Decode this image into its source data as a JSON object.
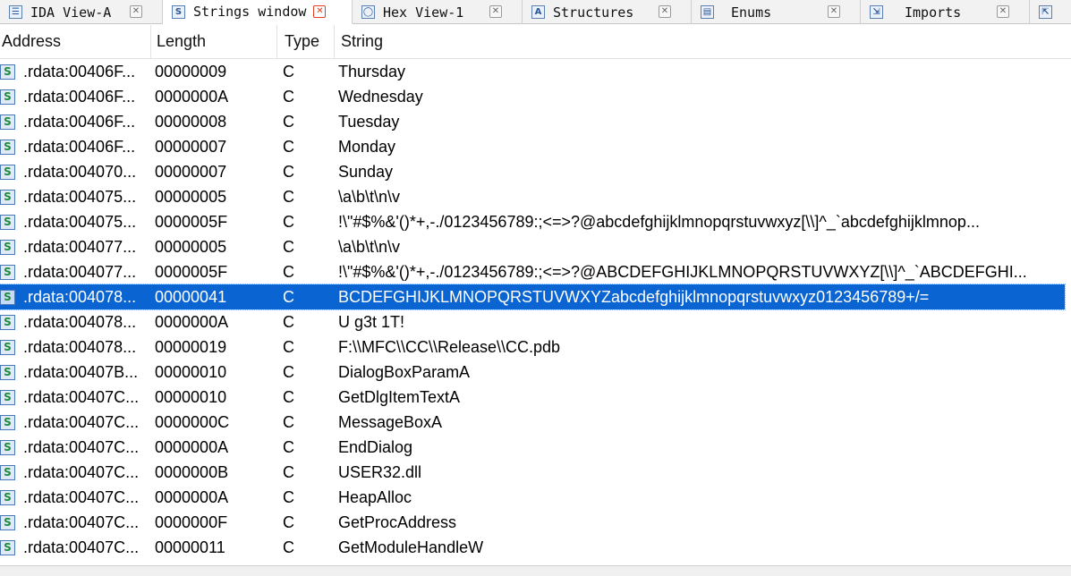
{
  "tabs": [
    {
      "label": "IDA View-A",
      "icon": "ida-view-icon"
    },
    {
      "label": "Strings window",
      "icon": "strings-icon",
      "active": true
    },
    {
      "label": "Hex View-1",
      "icon": "hex-view-icon"
    },
    {
      "label": "Structures",
      "icon": "structures-icon"
    },
    {
      "label": "Enums",
      "icon": "enums-icon"
    },
    {
      "label": "Imports",
      "icon": "imports-icon"
    },
    {
      "label": "",
      "icon": "exports-icon"
    }
  ],
  "columns": {
    "address": "Address",
    "length": "Length",
    "type": "Type",
    "string": "String"
  },
  "rows": [
    {
      "address": ".rdata:00406F...",
      "length": "00000009",
      "type": "C",
      "string": "Thursday"
    },
    {
      "address": ".rdata:00406F...",
      "length": "0000000A",
      "type": "C",
      "string": "Wednesday"
    },
    {
      "address": ".rdata:00406F...",
      "length": "00000008",
      "type": "C",
      "string": "Tuesday"
    },
    {
      "address": ".rdata:00406F...",
      "length": "00000007",
      "type": "C",
      "string": "Monday"
    },
    {
      "address": ".rdata:004070...",
      "length": "00000007",
      "type": "C",
      "string": "Sunday"
    },
    {
      "address": ".rdata:004075...",
      "length": "00000005",
      "type": "C",
      "string": "\\a\\b\\t\\n\\v"
    },
    {
      "address": ".rdata:004075...",
      "length": "0000005F",
      "type": "C",
      "string": " !\\\"#$%&'()*+,-./0123456789:;<=>?@abcdefghijklmnopqrstuvwxyz[\\\\]^_`abcdefghijklmnop..."
    },
    {
      "address": ".rdata:004077...",
      "length": "00000005",
      "type": "C",
      "string": "\\a\\b\\t\\n\\v"
    },
    {
      "address": ".rdata:004077...",
      "length": "0000005F",
      "type": "C",
      "string": " !\\\"#$%&'()*+,-./0123456789:;<=>?@ABCDEFGHIJKLMNOPQRSTUVWXYZ[\\\\]^_`ABCDEFGHI..."
    },
    {
      "address": ".rdata:004078...",
      "length": "00000041",
      "type": "C",
      "string": "BCDEFGHIJKLMNOPQRSTUVWXYZabcdefghijklmnopqrstuvwxyz0123456789+/=",
      "selected": true
    },
    {
      "address": ".rdata:004078...",
      "length": "0000000A",
      "type": "C",
      "string": "U g3t 1T!"
    },
    {
      "address": ".rdata:004078...",
      "length": "00000019",
      "type": "C",
      "string": "F:\\\\MFC\\\\CC\\\\Release\\\\CC.pdb"
    },
    {
      "address": ".rdata:00407B...",
      "length": "00000010",
      "type": "C",
      "string": "DialogBoxParamA"
    },
    {
      "address": ".rdata:00407C...",
      "length": "00000010",
      "type": "C",
      "string": "GetDlgItemTextA"
    },
    {
      "address": ".rdata:00407C...",
      "length": "0000000C",
      "type": "C",
      "string": "MessageBoxA"
    },
    {
      "address": ".rdata:00407C...",
      "length": "0000000A",
      "type": "C",
      "string": "EndDialog"
    },
    {
      "address": ".rdata:00407C...",
      "length": "0000000B",
      "type": "C",
      "string": "USER32.dll"
    },
    {
      "address": ".rdata:00407C...",
      "length": "0000000A",
      "type": "C",
      "string": "HeapAlloc"
    },
    {
      "address": ".rdata:00407C...",
      "length": "0000000F",
      "type": "C",
      "string": "GetProcAddress"
    },
    {
      "address": ".rdata:00407C...",
      "length": "00000011",
      "type": "C",
      "string": "GetModuleHandleW"
    }
  ],
  "colors": {
    "selection": "#0a64d2",
    "close_active": "#e0401b"
  }
}
